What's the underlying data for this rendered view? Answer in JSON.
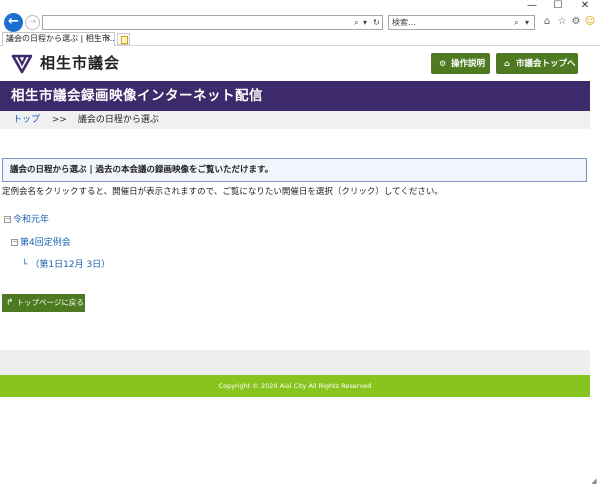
{
  "browser": {
    "window_controls": {
      "minimize": "—",
      "maximize": "☐",
      "close": "✕"
    },
    "back_icon": "←",
    "forward_icon": "→",
    "address_value": "",
    "address_search_glyph": "⌕",
    "address_dropdown_glyph": "▾",
    "address_refresh_glyph": "↻",
    "search_placeholder": "検索...",
    "search_glyph": "⌕",
    "search_dropdown_glyph": "▾",
    "toolbar_icons": {
      "home": "⌂",
      "favorites": "☆",
      "settings": "⚙",
      "feedback": "☺"
    },
    "tab_title": "議会の日程から選ぶ | 相生市...",
    "tab_close": "✕"
  },
  "header": {
    "logo_text": "相生市議会",
    "btn_help": "操作説明",
    "btn_help_icon": "⚙",
    "btn_top": "市議会トップへ",
    "btn_top_icon": "⌂"
  },
  "banner": {
    "title": "相生市議会録画映像インターネット配信"
  },
  "breadcrumb": {
    "home": "トップ",
    "separator": ">>",
    "current": "議会の日程から選ぶ"
  },
  "content": {
    "section_title": "議会の日程から選ぶ | 過去の本会議の録画映像をご覧いただけます。",
    "instruction": "定例会名をクリックすると、開催日が表示されますので、ご覧になりたい開催日を選択（クリック）してください。",
    "tree": {
      "toggle_symbol": "−",
      "year": "令和元年",
      "session": "第4回定例会",
      "corner": "└",
      "day": "（第1日12月 3日）"
    },
    "back_button": "トップページに戻る",
    "back_button_icon": "↱"
  },
  "footer": {
    "copyright": "Copyright © 2020 Aioi City All Rights Reserved"
  },
  "colors": {
    "brand_purple": "#3c2a6b",
    "button_green": "#4e7a21",
    "footer_green": "#88c41e",
    "link_blue": "#1b5fb0",
    "browser_blue": "#1b6fd1"
  }
}
